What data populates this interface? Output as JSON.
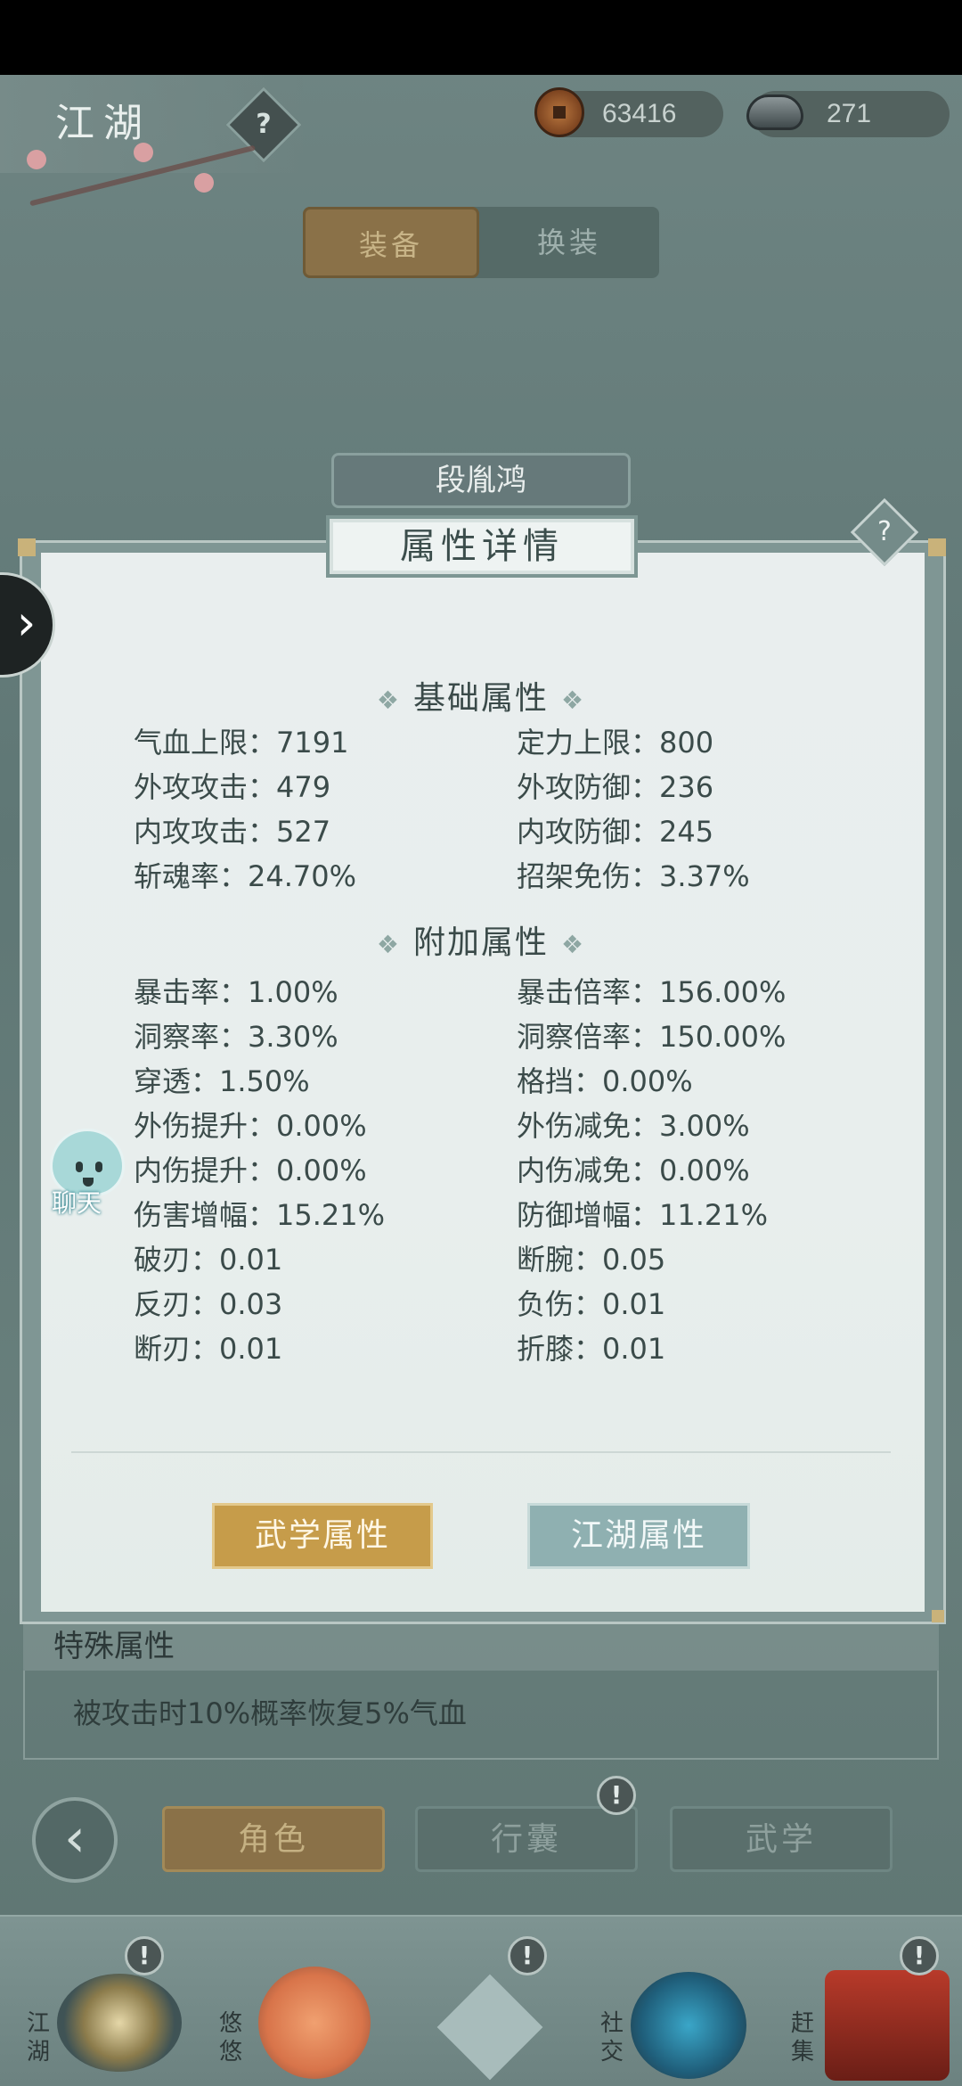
{
  "header": {
    "title": "江湖",
    "help_icon": "?",
    "copper": "63416",
    "silver": "271"
  },
  "equip_tabs": [
    "装备",
    "换装"
  ],
  "character_name": "段胤鸿",
  "dialog": {
    "title": "属性详情",
    "help_icon": "?",
    "basic_section": "基础属性",
    "basic_stats": [
      [
        "气血上限：7191",
        "定力上限：800"
      ],
      [
        "外攻攻击：479",
        "外攻防御：236"
      ],
      [
        "内攻攻击：527",
        "内攻防御：245"
      ],
      [
        "斩魂率：24.70%",
        "招架免伤：3.37%"
      ]
    ],
    "extra_section": "附加属性",
    "extra_stats": [
      [
        "暴击率：1.00%",
        "暴击倍率：156.00%"
      ],
      [
        "洞察率：3.30%",
        "洞察倍率：150.00%"
      ],
      [
        "穿透：1.50%",
        "格挡：0.00%"
      ],
      [
        "外伤提升：0.00%",
        "外伤减免：3.00%"
      ],
      [
        "内伤提升：0.00%",
        "内伤减免：0.00%"
      ],
      [
        "伤害增幅：15.21%",
        "防御增幅：11.21%"
      ],
      [
        "破刃：0.01",
        "断腕：0.05"
      ],
      [
        "反刃：0.03",
        "负伤：0.01"
      ],
      [
        "断刃：0.01",
        "折膝：0.01"
      ]
    ],
    "martial_button": "武学属性",
    "jianghu_button": "江湖属性"
  },
  "special": {
    "title": "特殊属性",
    "text": "被攻击时10%概率恢复5%气血"
  },
  "chat_label": "聊天",
  "nav_tabs": [
    "角色",
    "行囊",
    "武学"
  ],
  "badge_glyph": "!",
  "dock": [
    "江湖",
    "悠悠",
    "社交",
    "赶集"
  ],
  "colors": {
    "active_tab": "#8a7148",
    "panel": "#e9eeee",
    "martial_button": "#c69c4a",
    "jianghu_button": "#8fb0b1"
  }
}
